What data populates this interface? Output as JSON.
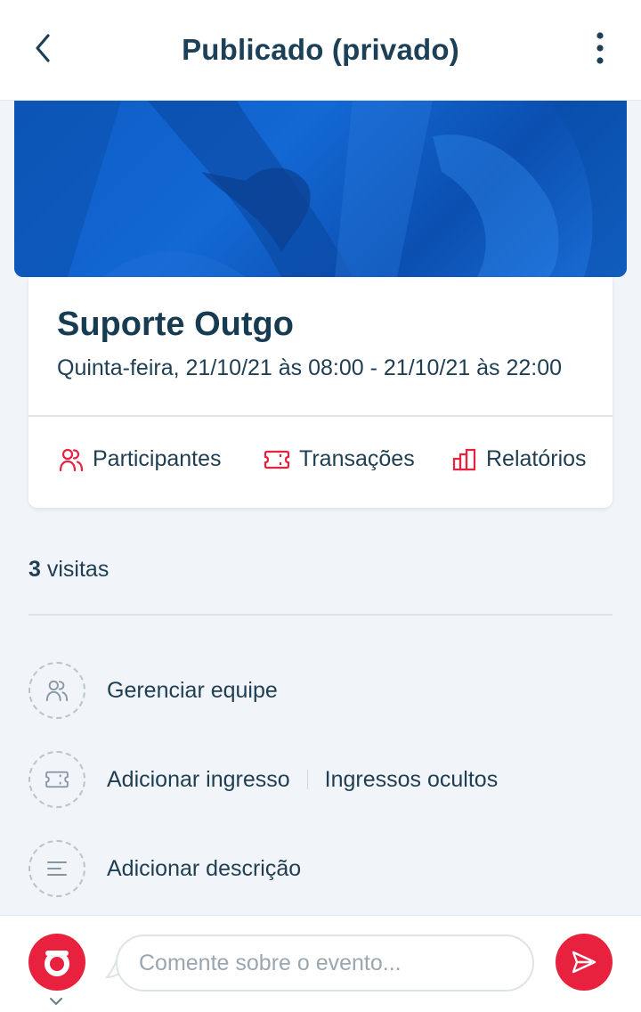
{
  "header": {
    "title": "Publicado (privado)",
    "back_icon": "chevron-left-icon",
    "menu_icon": "more-vertical-icon"
  },
  "event": {
    "name": "Suporte Outgo",
    "date_range": "Quinta-feira, 21/10/21 às 08:00 - 21/10/21 às 22:00"
  },
  "actions": [
    {
      "label": "Participantes",
      "icon": "users-icon"
    },
    {
      "label": "Transações",
      "icon": "ticket-icon"
    },
    {
      "label": "Relatórios",
      "icon": "bar-chart-icon"
    }
  ],
  "stats": {
    "visits_count": "3",
    "visits_label": "visitas"
  },
  "options": {
    "manage_team": "Gerenciar equipe",
    "add_ticket": "Adicionar ingresso",
    "hidden_tickets": "Ingressos ocultos",
    "add_description": "Adicionar descrição"
  },
  "comment": {
    "placeholder": "Comente sobre o evento..."
  },
  "colors": {
    "accent": "#e8213f",
    "title_text": "#1c4058",
    "banner_blue": "#0d5cc4",
    "background": "#f1f5f9"
  }
}
